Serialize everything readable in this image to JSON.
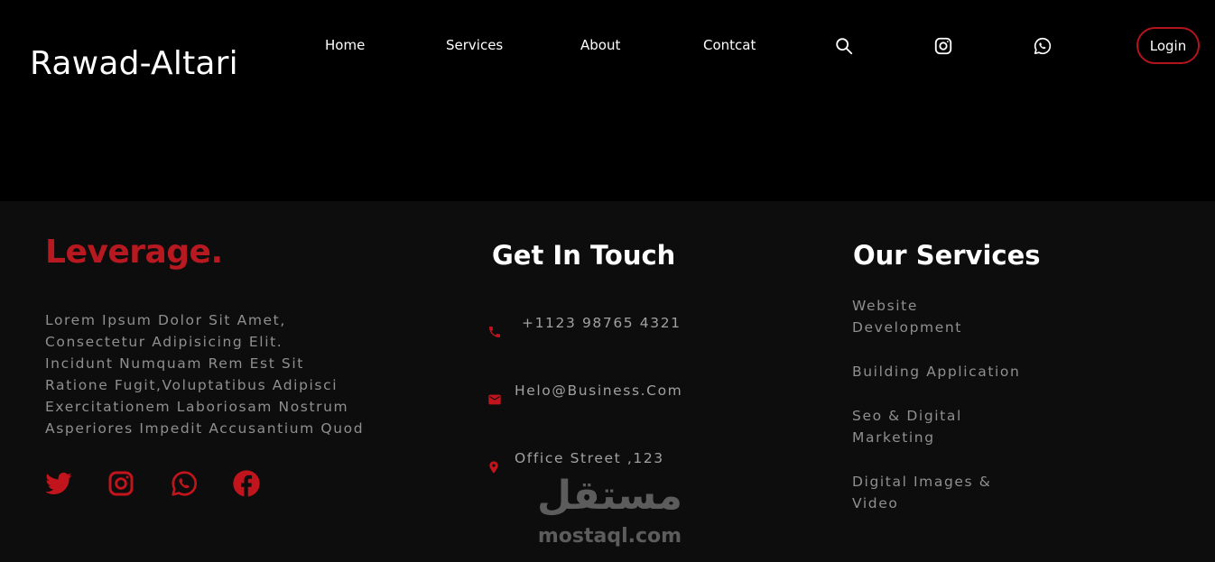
{
  "header": {
    "brand": "Rawad-Altari",
    "nav": [
      {
        "label": "Home"
      },
      {
        "label": "Services"
      },
      {
        "label": "About"
      },
      {
        "label": "Contcat"
      }
    ],
    "icons": [
      "search-icon",
      "instagram-icon",
      "whatsapp-icon"
    ],
    "login_label": "Login"
  },
  "footer": {
    "logo_text": "Leverage.",
    "about_lines": [
      "Lorem Ipsum Dolor Sit Amet,",
      "Consectetur Adipisicing Elit.",
      "Incidunt Numquam Rem Est Sit",
      "Ratione Fugit,Voluptatibus Adipisci",
      "Exercitationem Laboriosam Nostrum",
      "Asperiores Impedit Accusantium Quod"
    ],
    "social_icons": [
      "twitter-icon",
      "instagram-icon",
      "whatsapp-icon",
      "facebook-icon"
    ],
    "contact": {
      "title": "Get In Touch",
      "items": [
        {
          "icon": "phone-icon",
          "text": "+1123 98765 4321"
        },
        {
          "icon": "mail-icon",
          "text": "Helo@Business.Com"
        },
        {
          "icon": "location-pin-icon",
          "text": "Office Street ,123"
        }
      ]
    },
    "services": {
      "title": "Our Services",
      "items": [
        {
          "lines": [
            "Website",
            "Development"
          ]
        },
        {
          "lines": [
            "Building Application"
          ]
        },
        {
          "lines": [
            "Seo & Digital",
            "Marketing"
          ]
        },
        {
          "lines": [
            "Digital Images &",
            "Video"
          ]
        }
      ]
    }
  },
  "watermark": {
    "arabic": "مستقل",
    "latin": "mostaql.com"
  },
  "colors": {
    "accent": "#b81820",
    "header_bg": "#000000",
    "footer_bg": "#0d0d0d",
    "muted_text": "#8f8f8f"
  }
}
